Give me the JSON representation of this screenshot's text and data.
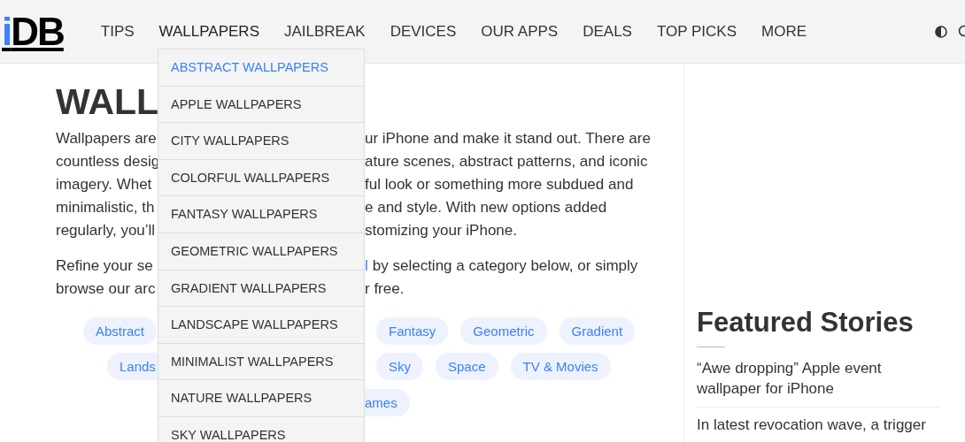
{
  "header": {
    "logo": {
      "accent": "i",
      "rest": "DB"
    },
    "nav": [
      {
        "label": "TIPS",
        "expanded": false
      },
      {
        "label": "WALLPAPERS",
        "expanded": true
      },
      {
        "label": "JAILBREAK",
        "expanded": false
      },
      {
        "label": "DEVICES",
        "expanded": false
      },
      {
        "label": "OUR APPS",
        "expanded": false
      },
      {
        "label": "DEALS",
        "expanded": false
      },
      {
        "label": "TOP PICKS",
        "expanded": false
      },
      {
        "label": "MORE",
        "expanded": false
      }
    ]
  },
  "dropdown": {
    "items": [
      {
        "label": "ABSTRACT WALLPAPERS",
        "selected": true
      },
      {
        "label": "APPLE WALLPAPERS",
        "selected": false
      },
      {
        "label": "CITY WALLPAPERS",
        "selected": false
      },
      {
        "label": "COLORFUL WALLPAPERS",
        "selected": false
      },
      {
        "label": "FANTASY WALLPAPERS",
        "selected": false
      },
      {
        "label": "GEOMETRIC WALLPAPERS",
        "selected": false
      },
      {
        "label": "GRADIENT WALLPAPERS",
        "selected": false
      },
      {
        "label": "LANDSCAPE WALLPAPERS",
        "selected": false
      },
      {
        "label": "MINIMALIST WALLPAPERS",
        "selected": false
      },
      {
        "label": "NATURE WALLPAPERS",
        "selected": false
      },
      {
        "label": "SKY WALLPAPERS",
        "selected": false
      }
    ]
  },
  "article": {
    "title": "WALL",
    "intro_lines": [
      {
        "left": "Wallpapers are",
        "right": "ur iPhone and make it stand out. There are"
      },
      {
        "left": "countless desig",
        "right": "ature scenes, abstract patterns, and iconic"
      },
      {
        "left": "imagery. Whet",
        "right": "ful look or something more subdued and"
      },
      {
        "left": "minimalistic, th",
        "right": "e and style. With new options added"
      },
      {
        "left": "regularly, you’ll",
        "right": "stomizing your iPhone."
      }
    ],
    "refine_lines": [
      {
        "left": "Refine your se",
        "link": "l",
        "right": "by selecting a category below, or simply"
      },
      {
        "left": "browse our arc",
        "right": "r free."
      }
    ],
    "tag_rows": [
      {
        "left": [
          {
            "label": "Abstract",
            "kind": "tag"
          }
        ],
        "right": [
          {
            "label": "Fantasy",
            "kind": "tag"
          },
          {
            "label": "Geometric",
            "kind": "tag"
          },
          {
            "label": "Gradient",
            "kind": "tag"
          }
        ]
      },
      {
        "left": [
          {
            "label": "Lands",
            "kind": "tag"
          }
        ],
        "right": [
          {
            "label": "Sky",
            "kind": "tag"
          },
          {
            "label": "Space",
            "kind": "tag"
          },
          {
            "label": "TV & Movies",
            "kind": "tag"
          }
        ]
      },
      {
        "left": [],
        "right": [
          {
            "label": "ames",
            "kind": "tag_cut"
          }
        ]
      }
    ]
  },
  "sidebar": {
    "title": "Featured Stories",
    "stories": [
      "“Awe dropping” Apple event wallpaper for iPhone",
      "In latest revocation wave, a trigger"
    ]
  }
}
